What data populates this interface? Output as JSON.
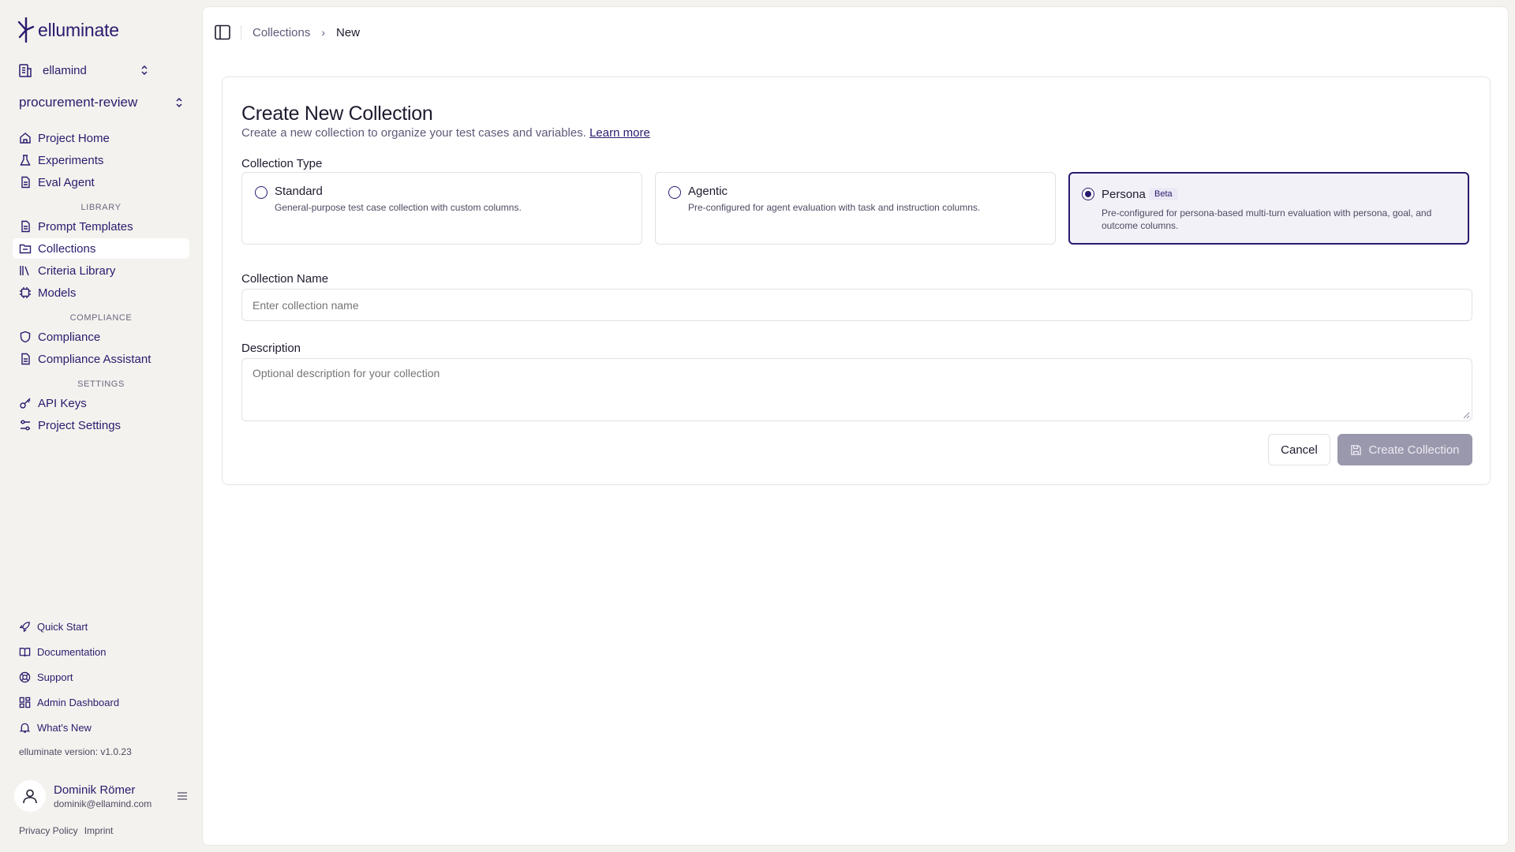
{
  "brand": {
    "name": "elluminate"
  },
  "org": {
    "name": "ellamind"
  },
  "project": {
    "name": "procurement-review"
  },
  "nav": {
    "project_home": "Project Home",
    "experiments": "Experiments",
    "eval_agent": "Eval Agent",
    "library_label": "LIBRARY",
    "prompt_templates": "Prompt Templates",
    "collections": "Collections",
    "criteria_library": "Criteria Library",
    "models": "Models",
    "compliance_label": "COMPLIANCE",
    "compliance": "Compliance",
    "compliance_assistant": "Compliance Assistant",
    "settings_label": "SETTINGS",
    "api_keys": "API Keys",
    "project_settings": "Project Settings"
  },
  "footer_nav": {
    "quick_start": "Quick Start",
    "documentation": "Documentation",
    "support": "Support",
    "admin_dashboard": "Admin Dashboard",
    "whats_new": "What's New"
  },
  "version": "elluminate version: v1.0.23",
  "user": {
    "name": "Dominik Römer",
    "email": "dominik@ellamind.com"
  },
  "legal": {
    "privacy": "Privacy Policy",
    "imprint": "Imprint"
  },
  "breadcrumb": {
    "parent": "Collections",
    "current": "New"
  },
  "form": {
    "title": "Create New Collection",
    "subtitle": "Create a new collection to organize your test cases and variables.",
    "learn_more": "Learn more",
    "type_label": "Collection Type",
    "types": [
      {
        "name": "Standard",
        "description": "General-purpose test case collection with custom columns.",
        "selected": false
      },
      {
        "name": "Agentic",
        "description": "Pre-configured for agent evaluation with task and instruction columns.",
        "selected": false
      },
      {
        "name": "Persona",
        "badge": "Beta",
        "description": "Pre-configured for persona-based multi-turn evaluation with persona, goal, and outcome columns.",
        "selected": true
      }
    ],
    "name_label": "Collection Name",
    "name_placeholder": "Enter collection name",
    "name_value": "",
    "description_label": "Description",
    "description_placeholder": "Optional description for your collection",
    "description_value": "",
    "cancel": "Cancel",
    "create": "Create Collection"
  },
  "colors": {
    "brand": "#2b1a6e",
    "sidebar_bg": "#f4f2ee",
    "disabled_button": "#9a98ad"
  }
}
